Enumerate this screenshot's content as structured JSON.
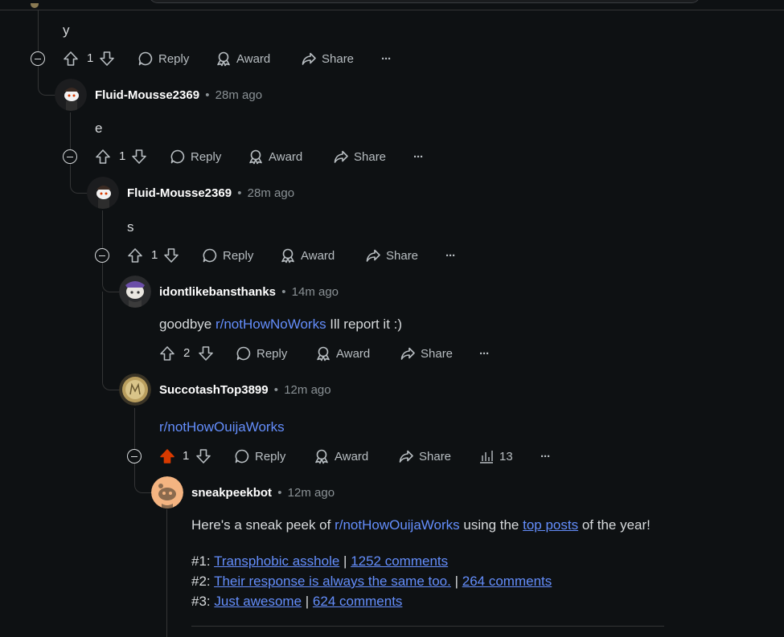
{
  "colors": {
    "background": "#0e1113",
    "text": "#d7dadc",
    "meta": "#8a9195",
    "link": "#648efc",
    "thread_line": "#343536",
    "upvote_active": "#d93a00"
  },
  "labels": {
    "reply": "Reply",
    "award": "Award",
    "share": "Share",
    "more": "···",
    "sep": "•"
  },
  "icons": [
    "upvote-icon",
    "downvote-icon",
    "reply-icon",
    "award-icon",
    "share-icon",
    "more-icon",
    "collapse-icon",
    "insights-icon"
  ],
  "comments": [
    {
      "body": "y",
      "score": "1"
    },
    {
      "author": "Fluid-Mousse2369",
      "time": "28m ago",
      "body": "e",
      "score": "1"
    },
    {
      "author": "Fluid-Mousse2369",
      "time": "28m ago",
      "body": "s",
      "score": "1"
    },
    {
      "author": "idontlikebansthanks",
      "time": "14m ago",
      "body_pre": "goodbye ",
      "body_link": "r/notHowNoWorks",
      "body_post": " Ill report it :)",
      "score": "2"
    },
    {
      "author": "SuccotashTop3899",
      "time": "12m ago",
      "body_link": "r/notHowOuijaWorks",
      "score": "1",
      "upvoted": true,
      "views": "13"
    },
    {
      "author": "sneakpeekbot",
      "time": "12m ago",
      "intro_pre": "Here's a sneak peek of ",
      "intro_link": "r/notHowOuijaWorks",
      "intro_mid": " using the ",
      "intro_link2": "top posts",
      "intro_post": " of the year!",
      "posts": [
        {
          "rank": "#1:",
          "title": "Transphobic asshole",
          "comments": "1252 comments"
        },
        {
          "rank": "#2:",
          "title": "Their response is always the same too.",
          "comments": "264 comments"
        },
        {
          "rank": "#3:",
          "title": "Just awesome",
          "comments": "624 comments"
        }
      ],
      "post_sep": " | "
    }
  ]
}
